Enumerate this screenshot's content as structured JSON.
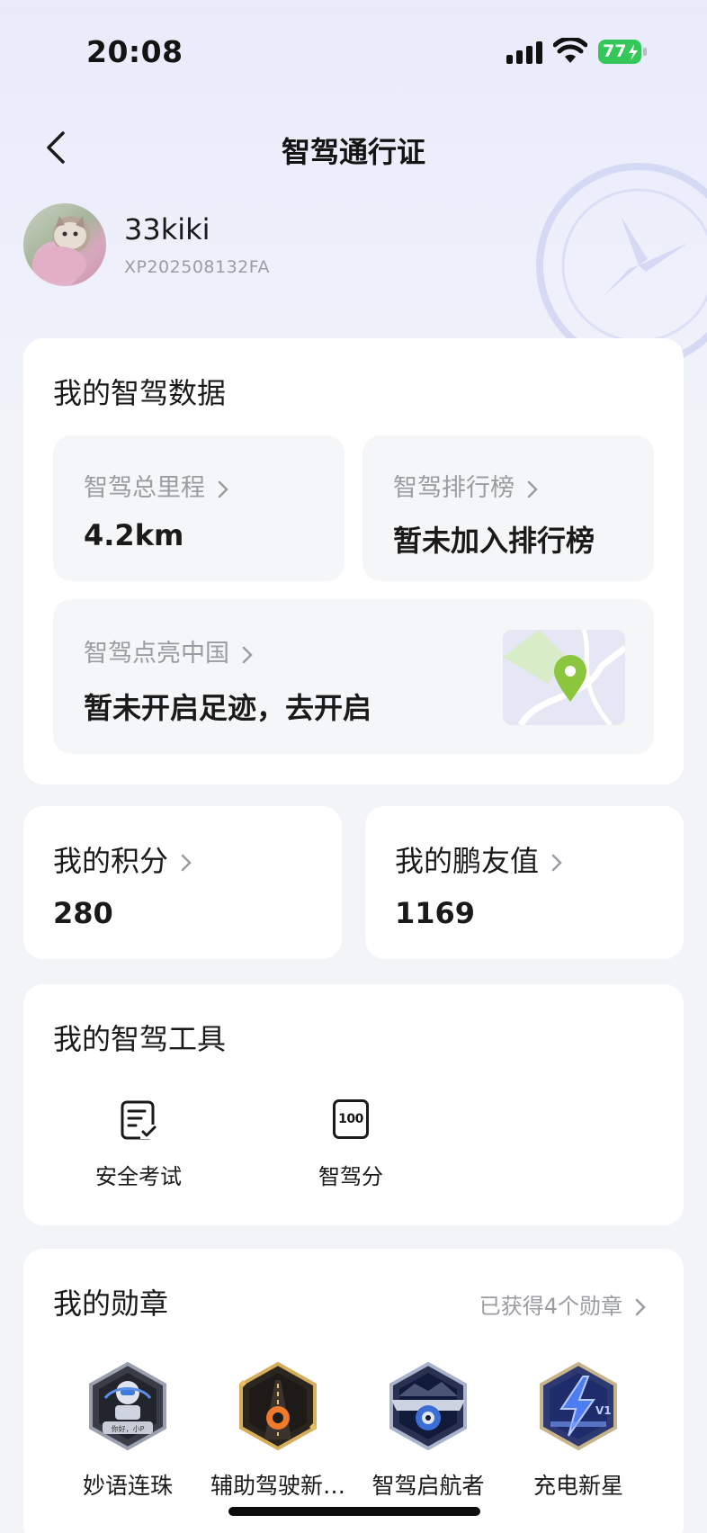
{
  "status_bar": {
    "time": "20:08",
    "battery": "77"
  },
  "nav": {
    "title": "智驾通行证"
  },
  "profile": {
    "username": "33kiki",
    "user_id": "XP202508132FA"
  },
  "driving_data": {
    "title": "我的智驾数据",
    "total_mileage": {
      "label": "智驾总里程",
      "value": "4.2km"
    },
    "ranking": {
      "label": "智驾排行榜",
      "value": "暂未加入排行榜"
    },
    "light_up_china": {
      "label": "智驾点亮中国",
      "value": "暂未开启足迹，去开启"
    }
  },
  "points": {
    "label": "我的积分",
    "value": "280"
  },
  "friend_value": {
    "label": "我的鹏友值",
    "value": "1169"
  },
  "tools": {
    "title": "我的智驾工具",
    "items": [
      {
        "label": "安全考试",
        "icon": "exam-checklist-icon"
      },
      {
        "label": "智驾分",
        "icon": "score-100-icon",
        "icon_text": "100"
      }
    ]
  },
  "medals": {
    "title": "我的勋章",
    "count_text": "已获得4个勋章",
    "items": [
      {
        "name": "妙语连珠",
        "icon": "robot-medal-icon",
        "icon_text": "你好，小P"
      },
      {
        "name": "辅助驾驶新…",
        "icon": "road-medal-icon"
      },
      {
        "name": "智驾启航者",
        "icon": "car-medal-icon"
      },
      {
        "name": "充电新星",
        "icon": "lightning-medal-icon",
        "icon_text": "V1"
      }
    ]
  },
  "colors": {
    "accent_green": "#8cc63f",
    "battery_green": "#34c759",
    "card_bg": "#ffffff",
    "tile_bg": "#f5f6f8",
    "muted_text": "#9b9ca3"
  }
}
